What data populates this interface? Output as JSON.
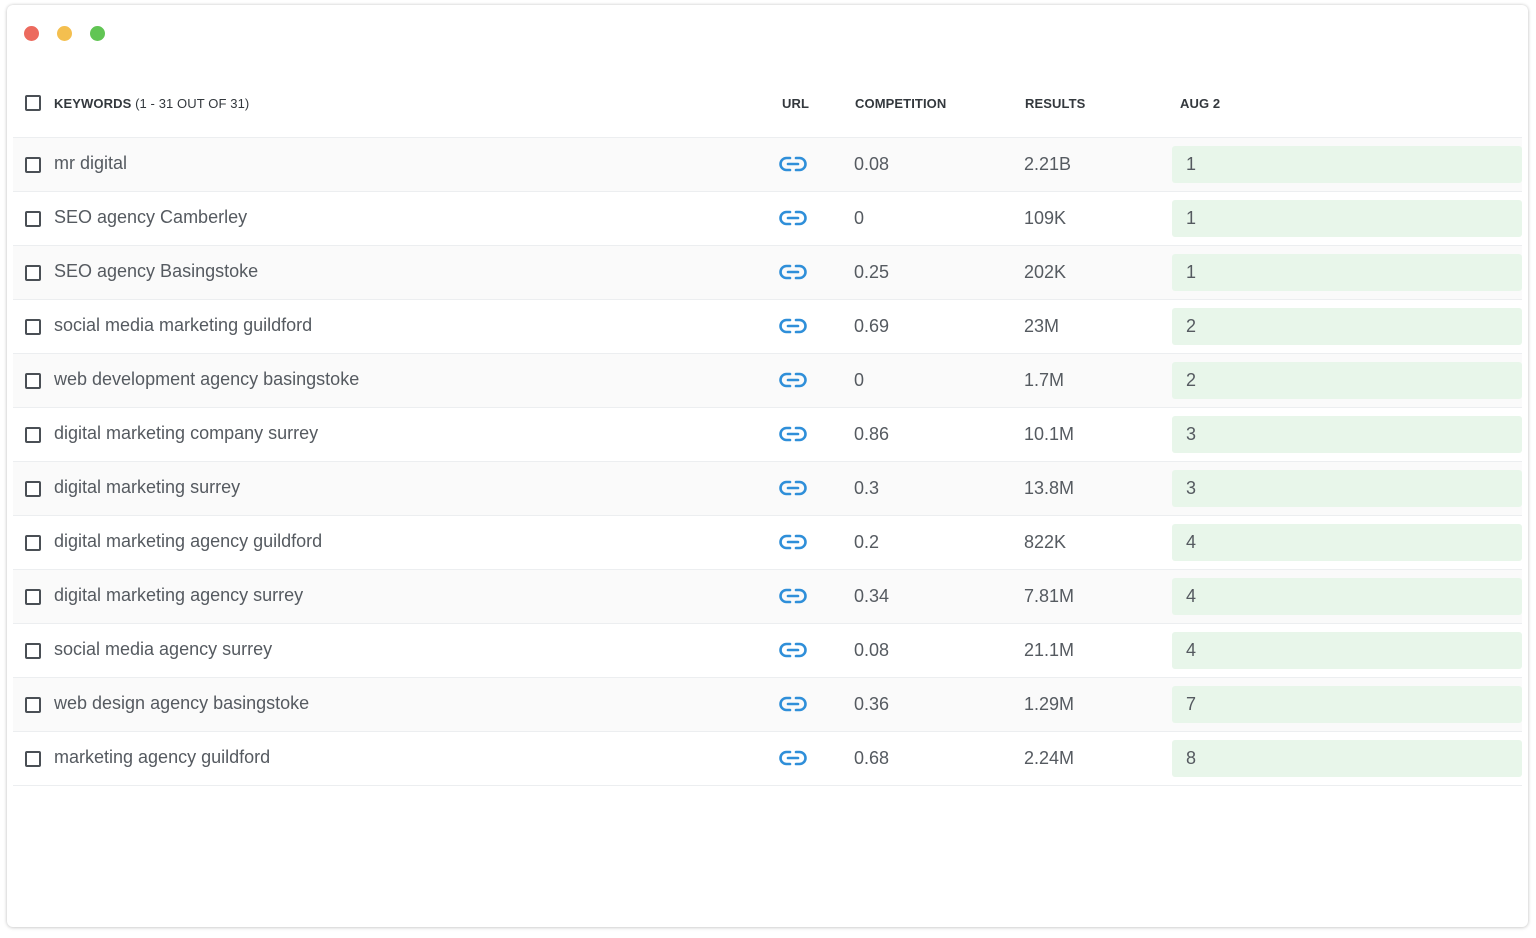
{
  "window": {
    "controls": [
      "close",
      "minimize",
      "maximize"
    ]
  },
  "header": {
    "keywords_label": "KEYWORDS",
    "keywords_count": "(1 - 31 OUT OF 31)",
    "url": "URL",
    "competition": "COMPETITION",
    "results": "RESULTS",
    "date": "AUG 2"
  },
  "colors": {
    "link_icon": "#2f8fd9",
    "rank_bg": "#e8f6ea"
  },
  "rows": [
    {
      "keyword": "mr digital",
      "competition": "0.08",
      "results": "2.21B",
      "rank": "1"
    },
    {
      "keyword": "SEO agency Camberley",
      "competition": "0",
      "results": "109K",
      "rank": "1"
    },
    {
      "keyword": "SEO agency Basingstoke",
      "competition": "0.25",
      "results": "202K",
      "rank": "1"
    },
    {
      "keyword": "social media marketing guildford",
      "competition": "0.69",
      "results": "23M",
      "rank": "2"
    },
    {
      "keyword": "web development agency basingstoke",
      "competition": "0",
      "results": "1.7M",
      "rank": "2"
    },
    {
      "keyword": "digital marketing company surrey",
      "competition": "0.86",
      "results": "10.1M",
      "rank": "3"
    },
    {
      "keyword": "digital marketing surrey",
      "competition": "0.3",
      "results": "13.8M",
      "rank": "3"
    },
    {
      "keyword": "digital marketing agency guildford",
      "competition": "0.2",
      "results": "822K",
      "rank": "4"
    },
    {
      "keyword": "digital marketing agency surrey",
      "competition": "0.34",
      "results": "7.81M",
      "rank": "4"
    },
    {
      "keyword": "social media agency surrey",
      "competition": "0.08",
      "results": "21.1M",
      "rank": "4"
    },
    {
      "keyword": "web design agency basingstoke",
      "competition": "0.36",
      "results": "1.29M",
      "rank": "7"
    },
    {
      "keyword": "marketing agency guildford",
      "competition": "0.68",
      "results": "2.24M",
      "rank": "8"
    }
  ]
}
